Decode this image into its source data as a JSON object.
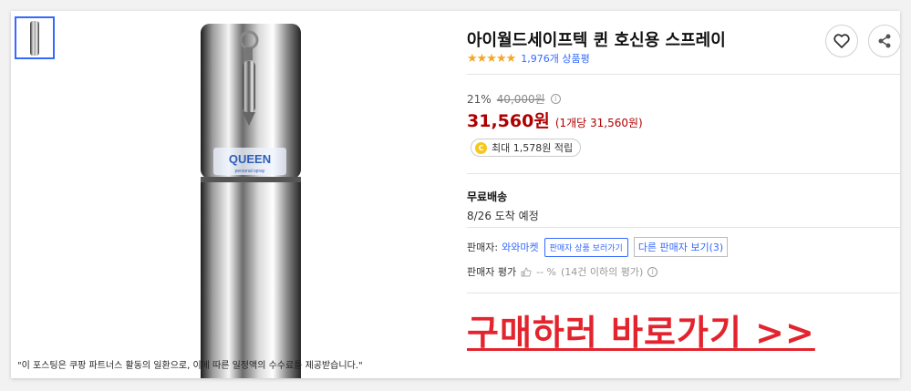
{
  "product": {
    "title": "아이월드세이프텍 퀸 호신용 스프레이",
    "rating_stars": "★★★★★",
    "rating_value": 4.5,
    "rating_count": "1,976개 상품평",
    "thumbnail_icon": "product-thumbnail",
    "image_brand_text": "QUEEN",
    "image_brand_sub": "personal spray",
    "disclaimer": "\"이 포스팅은 쿠팡 파트너스 활동의 일환으로, 이에 따른 일정액의 수수료를 제공받습니다.\""
  },
  "actions": {
    "heart_icon": "heart-icon",
    "share_icon": "share-icon"
  },
  "pricing": {
    "discount": "21%",
    "original_price": "40,000원",
    "info_icon": "i",
    "price": "31,560원",
    "unit_price": "(1개당 31,560원)",
    "coin_icon": "C",
    "cashback": "최대 1,578원 적립"
  },
  "shipping": {
    "label": "무료배송",
    "date": "8/26 도착 예정"
  },
  "seller": {
    "label": "판매자:",
    "name": "와와마켓",
    "popup_button": "판매자 상품 보러가기",
    "other_sellers": "다른 판매자 보기(3)",
    "eval_label": "판매자 평가",
    "eval_value": "-- %",
    "eval_note": "(14건 이하의 평가)"
  },
  "cta": {
    "buy_link": "구매하러 바로가기 >>"
  },
  "colors": {
    "accent_blue": "#346aff",
    "price_red": "#ae0000",
    "cta_red": "#e3232d",
    "star": "#f5a623"
  }
}
